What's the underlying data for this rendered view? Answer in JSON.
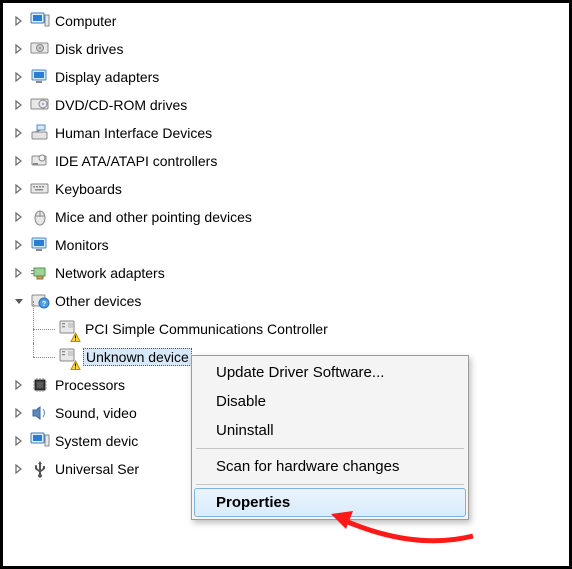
{
  "tree": {
    "items": [
      {
        "label": "Computer",
        "icon": "computer"
      },
      {
        "label": "Disk drives",
        "icon": "disk"
      },
      {
        "label": "Display adapters",
        "icon": "display"
      },
      {
        "label": "DVD/CD-ROM drives",
        "icon": "dvd"
      },
      {
        "label": "Human Interface Devices",
        "icon": "hid"
      },
      {
        "label": "IDE ATA/ATAPI controllers",
        "icon": "ide"
      },
      {
        "label": "Keyboards",
        "icon": "keyboard"
      },
      {
        "label": "Mice and other pointing devices",
        "icon": "mouse"
      },
      {
        "label": "Monitors",
        "icon": "monitor"
      },
      {
        "label": "Network adapters",
        "icon": "network"
      }
    ],
    "other_devices": {
      "label": "Other devices",
      "children": [
        {
          "label": "PCI Simple Communications Controller"
        },
        {
          "label": "Unknown device",
          "selected": true
        }
      ]
    },
    "items2": [
      {
        "label": "Processors",
        "icon": "cpu"
      },
      {
        "label": "Sound, video",
        "icon": "sound"
      },
      {
        "label": "System devic",
        "icon": "system"
      },
      {
        "label": "Universal Ser",
        "icon": "usb"
      }
    ]
  },
  "context_menu": {
    "items": [
      {
        "label": "Update Driver Software..."
      },
      {
        "label": "Disable"
      },
      {
        "label": "Uninstall"
      }
    ],
    "scan": "Scan for hardware changes",
    "properties": "Properties"
  }
}
